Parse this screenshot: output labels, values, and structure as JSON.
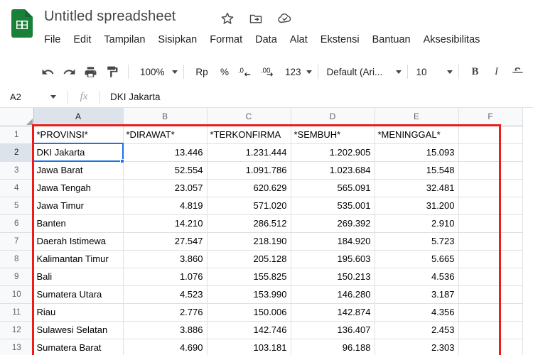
{
  "window": {
    "app_logo": "google-sheets-logo",
    "doc_title": "Untitled spreadsheet",
    "title_icons": [
      "star-icon",
      "move-to-folder-icon",
      "cloud-saved-icon"
    ]
  },
  "menubar": {
    "items": [
      {
        "label": "File"
      },
      {
        "label": "Edit"
      },
      {
        "label": "Tampilan"
      },
      {
        "label": "Sisipkan"
      },
      {
        "label": "Format"
      },
      {
        "label": "Data"
      },
      {
        "label": "Alat"
      },
      {
        "label": "Ekstensi"
      },
      {
        "label": "Bantuan"
      },
      {
        "label": "Aksesibilitas"
      }
    ]
  },
  "toolbar": {
    "undo_icon": "undo-icon",
    "redo_icon": "redo-icon",
    "print_icon": "print-icon",
    "paint_format_icon": "paint-format-icon",
    "zoom_value": "100%",
    "currency_label": "Rp",
    "percent_label": "%",
    "decrease_decimal_label": ".0",
    "increase_decimal_label": ".00",
    "number_format_label": "123",
    "font_name": "Default (Ari...",
    "font_size": "10",
    "bold_label": "B",
    "italic_label": "I",
    "strikethrough_label": "S"
  },
  "formula_bar": {
    "name_box_value": "A2",
    "fx_label": "fx",
    "formula_value": "DKI Jakarta"
  },
  "grid": {
    "columns": [
      "A",
      "B",
      "C",
      "D",
      "E",
      "F"
    ],
    "active_column": "A",
    "active_row": 2,
    "selected_cell": "A2",
    "rows": [
      {
        "n": 1,
        "cells": [
          "*PROVINSI*",
          "*DIRAWAT*",
          "*TERKONFIRMA",
          "*SEMBUH*",
          "*MENINGGAL*",
          ""
        ]
      },
      {
        "n": 2,
        "cells": [
          "DKI Jakarta",
          "13.446",
          "1.231.444",
          "1.202.905",
          "15.093",
          ""
        ]
      },
      {
        "n": 3,
        "cells": [
          "Jawa Barat",
          "52.554",
          "1.091.786",
          "1.023.684",
          "15.548",
          ""
        ]
      },
      {
        "n": 4,
        "cells": [
          "Jawa Tengah",
          "23.057",
          "620.629",
          "565.091",
          "32.481",
          ""
        ]
      },
      {
        "n": 5,
        "cells": [
          "Jawa Timur",
          "4.819",
          "571.020",
          "535.001",
          "31.200",
          ""
        ]
      },
      {
        "n": 6,
        "cells": [
          "Banten",
          "14.210",
          "286.512",
          "269.392",
          "2.910",
          ""
        ]
      },
      {
        "n": 7,
        "cells": [
          "Daerah Istimewa",
          "27.547",
          "218.190",
          "184.920",
          "5.723",
          ""
        ]
      },
      {
        "n": 8,
        "cells": [
          "Kalimantan Timur",
          "3.860",
          "205.128",
          "195.603",
          "5.665",
          ""
        ]
      },
      {
        "n": 9,
        "cells": [
          "Bali",
          "1.076",
          "155.825",
          "150.213",
          "4.536",
          ""
        ]
      },
      {
        "n": 10,
        "cells": [
          "Sumatera Utara",
          "4.523",
          "153.990",
          "146.280",
          "3.187",
          ""
        ]
      },
      {
        "n": 11,
        "cells": [
          "Riau",
          "2.776",
          "150.006",
          "142.874",
          "4.356",
          ""
        ]
      },
      {
        "n": 12,
        "cells": [
          "Sulawesi Selatan",
          "3.886",
          "142.746",
          "136.407",
          "2.453",
          ""
        ]
      },
      {
        "n": 13,
        "cells": [
          "Sumatera Barat",
          "4.690",
          "103.181",
          "96.188",
          "2.303",
          ""
        ]
      }
    ]
  },
  "annotation": {
    "shape": "red-rectangle-highlight",
    "color": "#ef1b1b"
  },
  "colors": {
    "sheets_green": "#1e8e3e",
    "selection_blue": "#1a73e8",
    "header_gray": "#f8f9fa",
    "annotation_red": "#ef1b1b"
  }
}
